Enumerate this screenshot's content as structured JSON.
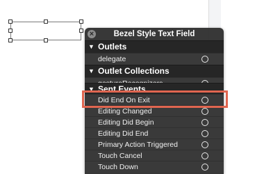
{
  "panel": {
    "title": "Bezel Style Text Field",
    "close_icon": "close-icon",
    "sections": {
      "outlets": {
        "label": "Outlets",
        "rows": [
          "delegate"
        ]
      },
      "outlet_collections": {
        "label": "Outlet Collections",
        "rows": [
          "gestureRecognizers"
        ]
      },
      "sent_events": {
        "label": "Sent Events",
        "rows": [
          "Did End On Exit",
          "Editing Changed",
          "Editing Did Begin",
          "Editing Did End",
          "Primary Action Triggered",
          "Touch Cancel",
          "Touch Down"
        ]
      }
    }
  },
  "colors": {
    "highlight": "#e06650",
    "panel_bg": "#303030"
  }
}
